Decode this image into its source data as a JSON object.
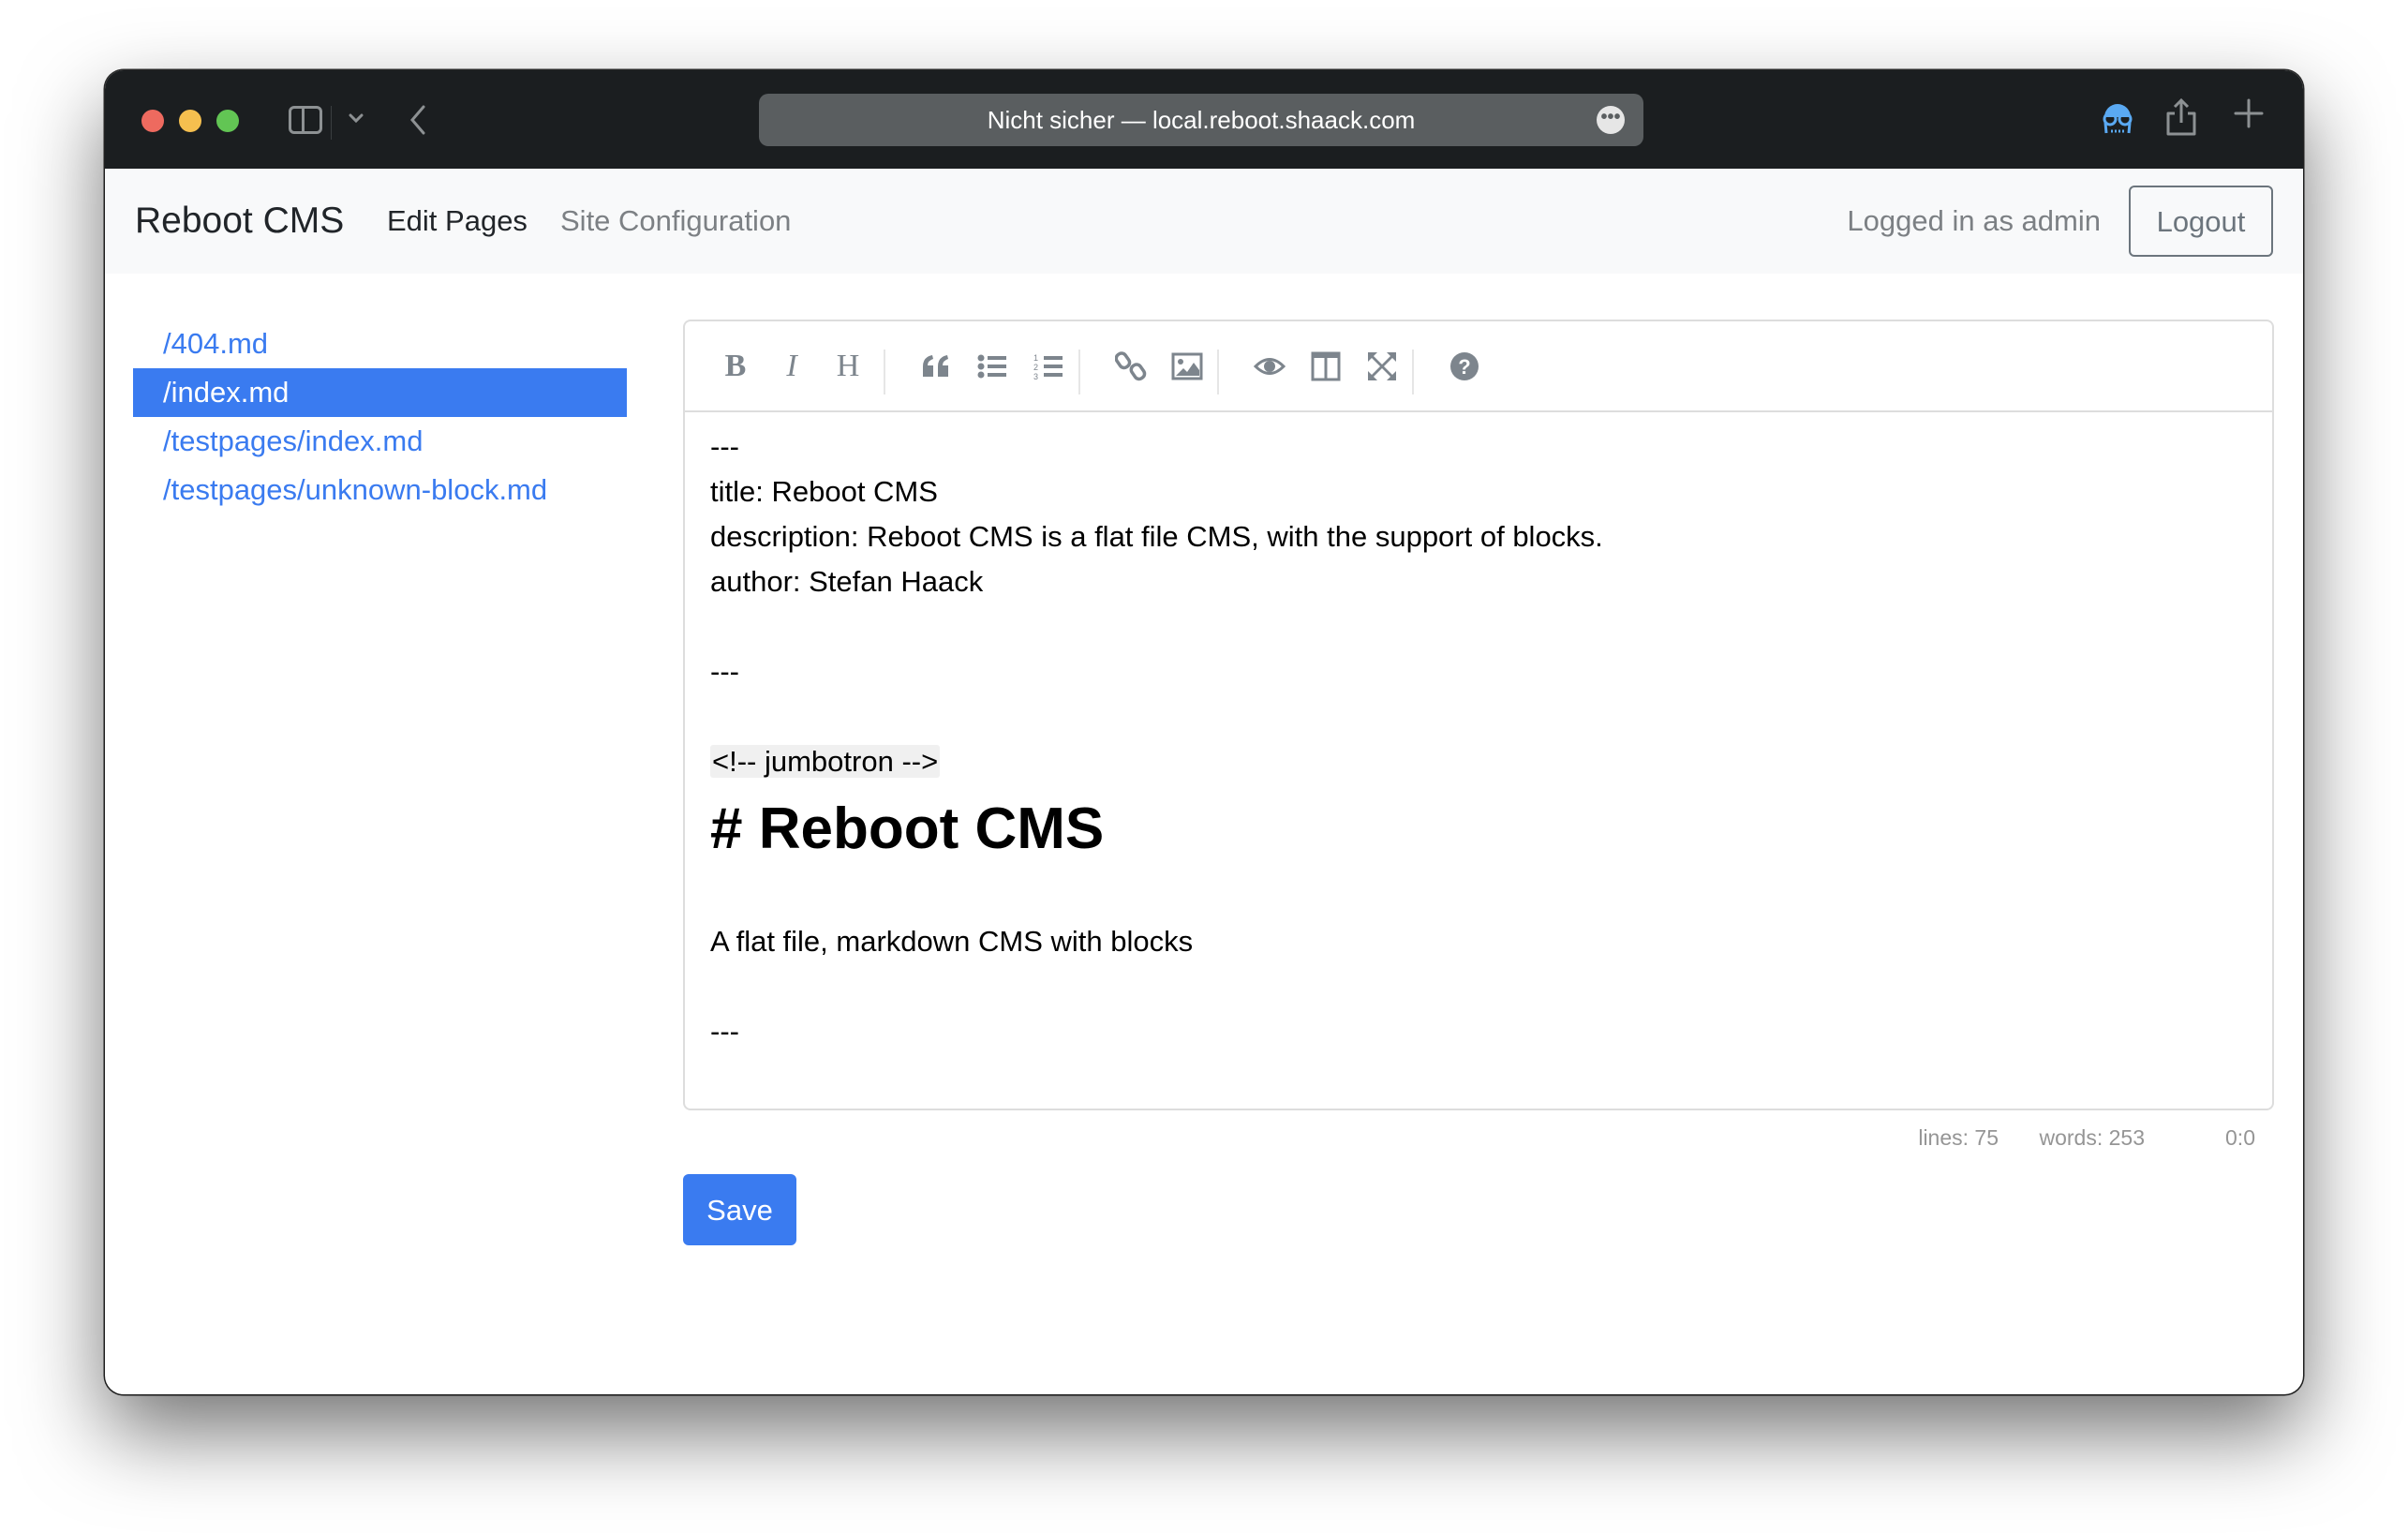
{
  "browser": {
    "url_text": "Nicht sicher — local.reboot.shaack.com",
    "more_icon": "•••"
  },
  "navbar": {
    "brand": "Reboot CMS",
    "links": [
      {
        "label": "Edit Pages",
        "active": true
      },
      {
        "label": "Site Configuration",
        "active": false
      }
    ],
    "logged_in_text": "Logged in as admin",
    "logout_label": "Logout"
  },
  "files": [
    {
      "label": "/404.md",
      "active": false
    },
    {
      "label": "/index.md",
      "active": true
    },
    {
      "label": "/testpages/index.md",
      "active": false
    },
    {
      "label": "/testpages/unknown-block.md",
      "active": false
    }
  ],
  "toolbar": {
    "bold": "B",
    "italic": "I",
    "heading": "H",
    "icons": [
      "bold-icon",
      "italic-icon",
      "heading-icon",
      "quote-icon",
      "unordered-list-icon",
      "ordered-list-icon",
      "link-icon",
      "image-icon",
      "preview-icon",
      "side-by-side-icon",
      "fullscreen-icon",
      "help-icon"
    ]
  },
  "editor": {
    "lines": [
      "---",
      "title: Reboot CMS",
      "description: Reboot CMS is a flat file CMS, with the support of blocks.",
      "author: Stefan Haack",
      "",
      "---",
      "",
      "<!-- jumbotron -->",
      "# Reboot CMS",
      "",
      "A flat file, markdown CMS with blocks",
      "",
      "---"
    ]
  },
  "status": {
    "lines": "lines: 75",
    "words": "words: 253",
    "cursor": "0:0"
  },
  "save_label": "Save",
  "colors": {
    "accent": "#3a7bf0",
    "titlebar": "#1b1e20",
    "navbar": "#f8f9fa",
    "muted": "#7c8084"
  }
}
